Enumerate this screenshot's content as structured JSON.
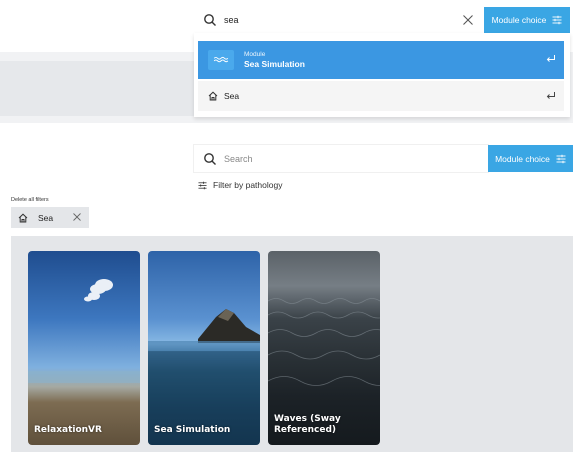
{
  "top": {
    "search": {
      "value": "sea"
    },
    "module_button": {
      "label": "Module choice"
    },
    "dropdown": {
      "module_item": {
        "category": "Module",
        "name": "Sea Simulation"
      },
      "pathology_item": {
        "name": "Sea"
      }
    }
  },
  "bottom": {
    "search": {
      "placeholder": "Search"
    },
    "module_button": {
      "label": "Module choice"
    },
    "filter_link": "Filter by pathology",
    "delete_filters": "Delete all filters",
    "active_filter": "Sea",
    "cards": [
      {
        "title": "RelaxationVR"
      },
      {
        "title": "Sea Simulation"
      },
      {
        "title": "Waves (Sway Referenced)"
      }
    ]
  },
  "colors": {
    "accent": "#3aa6e4",
    "selected": "#3b97e2"
  }
}
